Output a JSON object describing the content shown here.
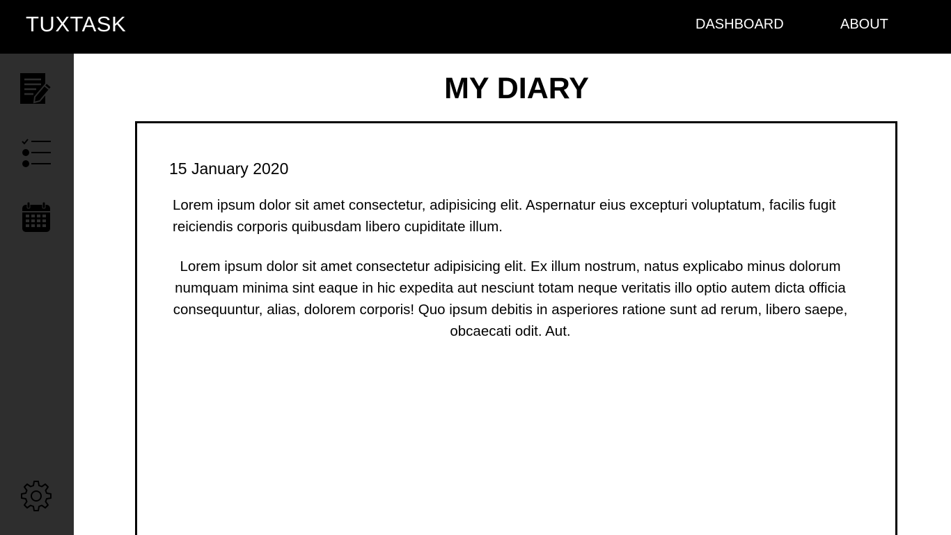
{
  "app": {
    "brand": "TUXTASK"
  },
  "nav": {
    "dashboard": "DASHBOARD",
    "about": "ABOUT"
  },
  "sidebar": {
    "items": [
      {
        "name": "diary",
        "icon": "edit-document-icon"
      },
      {
        "name": "tasks",
        "icon": "checklist-icon"
      },
      {
        "name": "calendar",
        "icon": "calendar-icon"
      },
      {
        "name": "settings",
        "icon": "gear-icon"
      }
    ]
  },
  "page": {
    "title": "MY DIARY"
  },
  "entry": {
    "date": "15 January 2020",
    "paragraphs": [
      "Lorem ipsum dolor sit amet consectetur, adipisicing elit. Aspernatur eius excepturi voluptatum, facilis fugit reiciendis corporis quibusdam libero cupiditate illum.",
      "Lorem ipsum dolor sit amet consectetur adipisicing elit. Ex illum nostrum, natus explicabo minus dolorum numquam minima sint eaque in hic expedita aut nesciunt totam neque veritatis illo optio autem dicta officia consequuntur, alias, dolorem corporis! Quo ipsum debitis in asperiores ratione sunt ad rerum, libero saepe, obcaecati odit. Aut."
    ]
  },
  "colors": {
    "topbar": "#000000",
    "sidebar": "#2e2e2e",
    "background": "#ffffff",
    "text": "#000000"
  }
}
